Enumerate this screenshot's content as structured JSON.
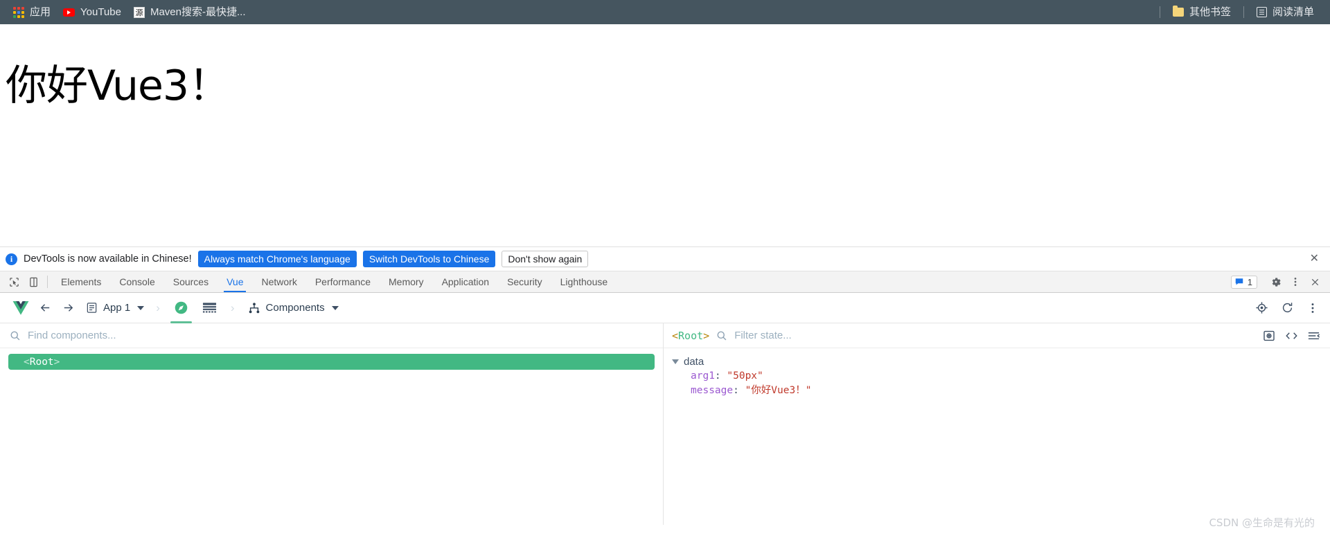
{
  "bookmarks_bar": {
    "left_items": [
      {
        "label": "应用",
        "icon": "apps-grid-icon"
      },
      {
        "label": "YouTube",
        "icon": "youtube-icon"
      },
      {
        "label": "Maven搜索-最快捷...",
        "icon": "maven-icon",
        "icon_glyph": "源"
      }
    ],
    "right_items": [
      {
        "label": "其他书签",
        "icon": "folder-icon"
      },
      {
        "label": "阅读清单",
        "icon": "reading-list-icon"
      }
    ],
    "background_color": "#45555f",
    "text_color": "#e8eaed"
  },
  "page": {
    "heading": "你好Vue3！"
  },
  "devtools_notice": {
    "info_icon": "info-icon",
    "message": "DevTools is now available in Chinese!",
    "primary_button": "Always match Chrome's language",
    "secondary_button": "Switch DevTools to Chinese",
    "dismiss_button": "Don't show again",
    "close_icon": "close-icon",
    "accent_color": "#1a73e8"
  },
  "devtools_tabs": {
    "inspect_icon": "inspect-element-icon",
    "device_icon": "device-toolbar-icon",
    "tabs": [
      {
        "label": "Elements",
        "active": false
      },
      {
        "label": "Console",
        "active": false
      },
      {
        "label": "Sources",
        "active": false
      },
      {
        "label": "Vue",
        "active": true
      },
      {
        "label": "Network",
        "active": false
      },
      {
        "label": "Performance",
        "active": false
      },
      {
        "label": "Memory",
        "active": false
      },
      {
        "label": "Application",
        "active": false
      },
      {
        "label": "Security",
        "active": false
      },
      {
        "label": "Lighthouse",
        "active": false
      }
    ],
    "message_count": "1",
    "message_icon": "message-icon",
    "settings_icon": "gear-icon",
    "more_icon": "more-vertical-icon",
    "close_icon": "close-icon",
    "active_color": "#1a73e8"
  },
  "vue_toolbar": {
    "logo": "vue-logo-icon",
    "back_icon": "arrow-left-icon",
    "forward_icon": "arrow-right-icon",
    "app_icon": "app-icon",
    "app_label": "App 1",
    "app_dropdown_icon": "chevron-down-icon",
    "separator_icon": "chevron-right-icon",
    "compass_icon": "compass-icon",
    "grid_icon": "grid-icon",
    "components_icon": "components-tree-icon",
    "components_label": "Components",
    "components_dropdown_icon": "chevron-down-icon",
    "target_icon": "target-icon",
    "refresh_icon": "refresh-icon",
    "more_icon": "more-vertical-icon",
    "accent_color": "#42b883"
  },
  "component_tree": {
    "search_icon": "search-icon",
    "search_placeholder": "Find components...",
    "search_value": "",
    "nodes": [
      {
        "open_angle": "<",
        "name": "Root",
        "close_angle": ">",
        "selected": true
      }
    ],
    "selected_color": "#42b883"
  },
  "state_panel": {
    "root_open_angle": "<",
    "root_name": "Root",
    "root_close_angle": ">",
    "filter_icon": "search-icon",
    "filter_placeholder": "Filter state...",
    "filter_value": "",
    "inspect_icon": "inspect-dom-icon",
    "code_icon": "code-icon",
    "collapse_icon": "collapse-all-icon",
    "groups": [
      {
        "name": "data",
        "expanded": true,
        "expand_icon": "triangle-down-icon",
        "rows": [
          {
            "key": "arg1",
            "separator": ":",
            "value": "\"50px\""
          },
          {
            "key": "message",
            "separator": ":",
            "value": "\"你好Vue3！\""
          }
        ]
      }
    ]
  },
  "watermark": {
    "text": "CSDN @生命是有光的"
  }
}
